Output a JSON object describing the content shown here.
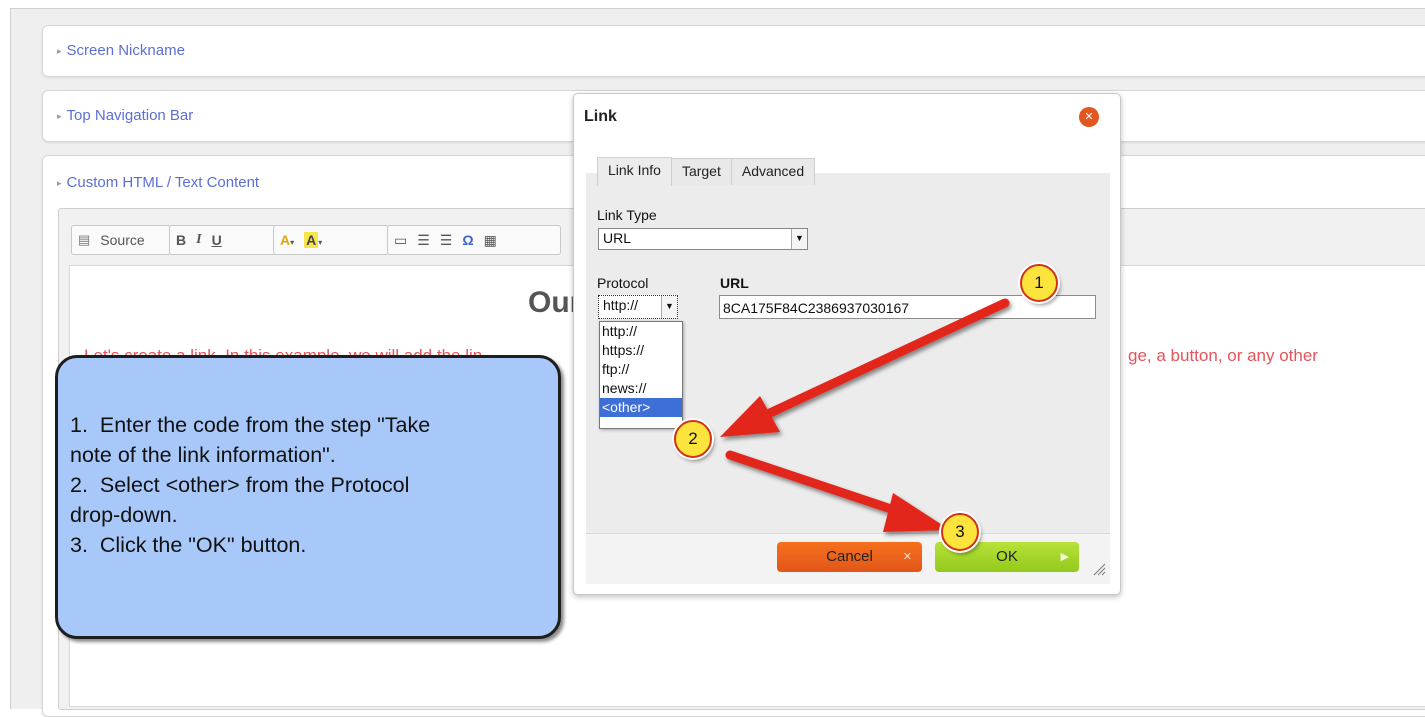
{
  "panels": [
    {
      "label": "Screen Nickname"
    },
    {
      "label": "Top Navigation Bar"
    },
    {
      "label": "Custom HTML / Text Content"
    }
  ],
  "toolbar": {
    "source_label": "Source",
    "bold": "B",
    "italic": "I",
    "underline": "U",
    "text_color": "A",
    "bg_color": "A",
    "omega": "Ω"
  },
  "editor": {
    "heading": "Our",
    "text_left": "Let's create a link.  In this example, we will add the lin",
    "text_right": "ge, a button, or any other"
  },
  "callout": {
    "text": "1.  Enter the code from the step \"Take\nnote of the link information\".\n2.  Select <other> from the Protocol\ndrop-down.\n3.  Click the \"OK\" button."
  },
  "dialog": {
    "title": "Link",
    "tabs": [
      "Link Info",
      "Target",
      "Advanced"
    ],
    "link_type_label": "Link Type",
    "link_type_value": "URL",
    "protocol_label": "Protocol",
    "protocol_value": "http://",
    "url_label": "URL",
    "url_value": "8CA175F84C2386937030167",
    "protocol_options": [
      "http://",
      "https://",
      "ftp://",
      "news://",
      "<other>"
    ],
    "cancel_label": "Cancel",
    "ok_label": "OK"
  },
  "badges": [
    "1",
    "2",
    "3"
  ],
  "colors": {
    "link_blue": "#5b6fd6",
    "editor_red": "#e5545a",
    "callout_fill": "#a9c8fa",
    "annotation_red": "#e3281a",
    "badge_yellow": "#fde43c",
    "cancel_orange": "#e2561a",
    "ok_green": "#94c91c",
    "selection_blue": "#3e6fd6"
  }
}
